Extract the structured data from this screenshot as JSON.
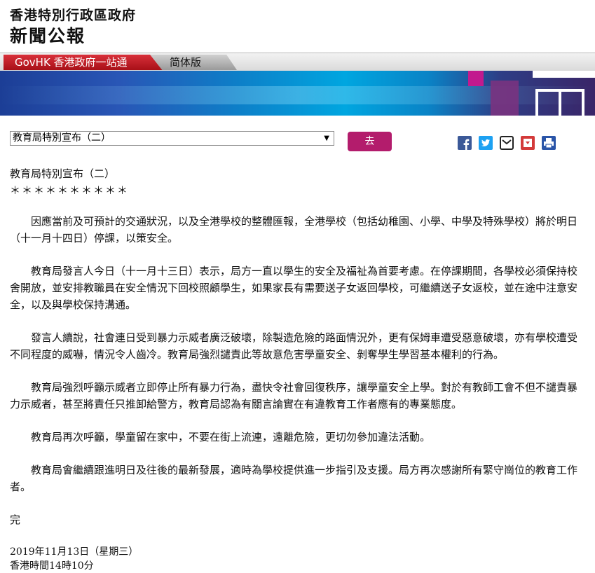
{
  "header": {
    "org_name": "香港特別行政區政府",
    "title": "新聞公報"
  },
  "nav": {
    "govhk_tab": "GovHK 香港政府一站通",
    "simplified_tab": "简体版"
  },
  "selector": {
    "selected_value": "教育局特別宣布（二）",
    "go_label": "去"
  },
  "share_icons": [
    "facebook-icon",
    "twitter-icon",
    "email-icon",
    "bookmark-icon",
    "print-icon"
  ],
  "colors": {
    "go_button": "#b31c6c",
    "govhk_tab": "#c8222c",
    "facebook": "#3b5998",
    "twitter": "#1da1f2",
    "bookmark": "#d33a3a",
    "print": "#2a55a8"
  },
  "article": {
    "headline": "教育局特別宣布（二）",
    "stars": "＊＊＊＊＊＊＊＊＊＊",
    "paragraphs": [
      "因應當前及可預計的交通狀況，以及全港學校的整體匯報，全港學校（包括幼稚園、小學、中學及特殊學校）將於明日（十一月十四日）停課，以策安全。",
      "教育局發言人今日（十一月十三日）表示，局方一直以學生的安全及福祉為首要考慮。在停課期間，各學校必須保持校舍開放，並安排教職員在安全情況下回校照顧學生，如果家長有需要送子女返回學校，可繼續送子女返校，並在途中注意安全，以及與學校保持溝通。",
      "發言人續說，社會連日受到暴力示威者廣泛破壞，除製造危險的路面情況外，更有保姆車遭受惡意破壞，亦有學校遭受不同程度的威嚇，情況令人齒冷。教育局強烈譴責此等故意危害學童安全、剝奪學生學習基本權利的行為。",
      "教育局強烈呼籲示威者立即停止所有暴力行為，盡快令社會回復秩序，讓學童安全上學。對於有教師工會不但不譴責暴力示威者，甚至將責任只推卸給警方，教育局認為有關言論實在有違教育工作者應有的專業態度。",
      "教育局再次呼籲，學童留在家中，不要在街上流連，遠離危險，更切勿參加違法活動。",
      "教育局會繼續跟進明日及往後的最新發展，適時為學校提供進一步指引及支援。局方再次感謝所有緊守崗位的教育工作者。"
    ],
    "end_mark": "完",
    "date": "2019年11月13日（星期三）",
    "time": "香港時間14時10分"
  }
}
